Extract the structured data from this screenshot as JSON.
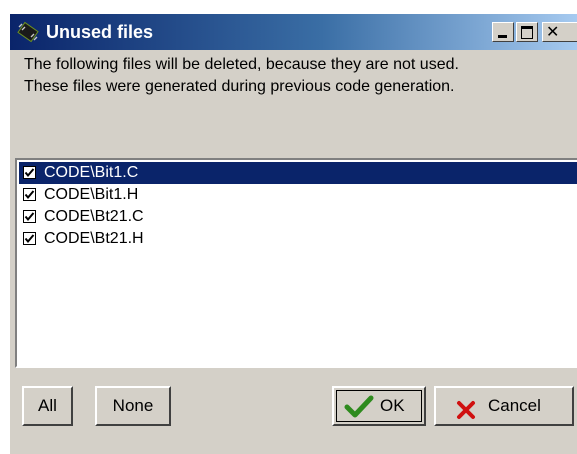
{
  "window": {
    "title": "Unused files",
    "controls": {
      "minimize_icon": "minimize-icon",
      "maximize_icon": "maximize-icon",
      "close_icon": "close-icon"
    }
  },
  "message": {
    "line1": "The following files will be deleted, because they are not used.",
    "line2": "These files were generated during previous code generation."
  },
  "files": [
    {
      "label": "CODE\\Bit1.C",
      "checked": true,
      "selected": true
    },
    {
      "label": "CODE\\Bit1.H",
      "checked": true,
      "selected": false
    },
    {
      "label": "CODE\\Bt21.C",
      "checked": true,
      "selected": false
    },
    {
      "label": "CODE\\Bt21.H",
      "checked": true,
      "selected": false
    }
  ],
  "buttons": {
    "all": "All",
    "none": "None",
    "ok": "OK",
    "cancel": "Cancel"
  },
  "colors": {
    "titlebar_start": "#0a246a",
    "selection": "#0a246a",
    "dialog_face": "#d4d0c8",
    "ok_check": "#2e8b1e",
    "cancel_x": "#d01010"
  }
}
